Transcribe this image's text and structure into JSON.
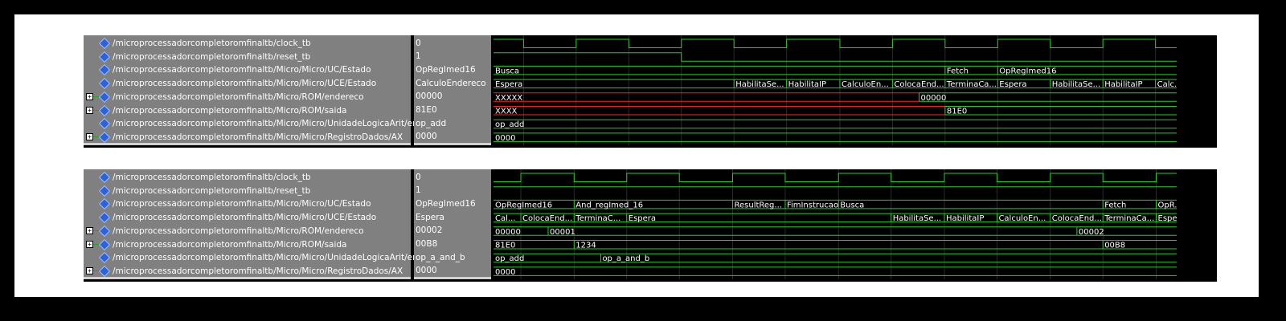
{
  "colors": {
    "background": "#000000",
    "frame": "#ffffff",
    "pane": "#808080",
    "wave_green": "#1fd11f",
    "wave_red": "#ff1e1e",
    "grid": "#2a2a2a",
    "diamond": "#2d62d8"
  },
  "icons": {
    "signal": "diamond-icon",
    "expand": "plus-box-icon"
  },
  "panels": [
    {
      "signals": [
        {
          "name": "/microprocessadorcompletoromfinaltb/clock_tb",
          "value": "0",
          "expandable": false
        },
        {
          "name": "/microprocessadorcompletoromfinaltb/reset_tb",
          "value": "1",
          "expandable": false
        },
        {
          "name": "/microprocessadorcompletoromfinaltb/Micro/Micro/UC/Estado",
          "value": "OpRegImed16",
          "expandable": false
        },
        {
          "name": "/microprocessadorcompletoromfinaltb/Micro/Micro/UCE/Estado",
          "value": "CalculoEndereco",
          "expandable": false
        },
        {
          "name": "/microprocessadorcompletoromfinaltb/Micro/ROM/endereco",
          "value": "00000",
          "expandable": true
        },
        {
          "name": "/microprocessadorcompletoromfinaltb/Micro/ROM/saida",
          "value": "81E0",
          "expandable": true
        },
        {
          "name": "/microprocessadorcompletoromfinaltb/Micro/Micro/UnidadeLogicaArit/enum_op",
          "value": "op_add",
          "expandable": false
        },
        {
          "name": "/microprocessadorcompletoromfinaltb/Micro/Micro/RegistroDados/AX",
          "value": "0000",
          "expandable": true
        }
      ],
      "waves": [
        {
          "kind": "clock",
          "color": "green",
          "edges": [
            0,
            0.044,
            0.121,
            0.198,
            0.275,
            0.352,
            0.429,
            0.507,
            0.584,
            0.661,
            0.738,
            0.815,
            0.892,
            0.969
          ],
          "start_high": true
        },
        {
          "kind": "bit",
          "color": "green",
          "segments": [
            {
              "from": 0,
              "to": 0.275,
              "level": 1
            },
            {
              "from": 0.275,
              "to": 1,
              "level": 0
            }
          ]
        },
        {
          "kind": "bus",
          "color": "green",
          "segments": [
            {
              "from": 0,
              "to": 0.661,
              "label": "Busca"
            },
            {
              "from": 0.661,
              "to": 0.738,
              "label": "Fetch"
            },
            {
              "from": 0.738,
              "to": 1,
              "label": "OpRegImed16"
            }
          ]
        },
        {
          "kind": "bus",
          "color": "green",
          "segments": [
            {
              "from": 0,
              "to": 0.352,
              "label": "Espera"
            },
            {
              "from": 0.352,
              "to": 0.429,
              "label": "HabilitaSe..."
            },
            {
              "from": 0.429,
              "to": 0.507,
              "label": "HabilitaIP"
            },
            {
              "from": 0.507,
              "to": 0.584,
              "label": "CalculoEn..."
            },
            {
              "from": 0.584,
              "to": 0.661,
              "label": "ColocaEnd..."
            },
            {
              "from": 0.661,
              "to": 0.738,
              "label": "TerminaCa..."
            },
            {
              "from": 0.738,
              "to": 0.815,
              "label": "Espera"
            },
            {
              "from": 0.815,
              "to": 0.892,
              "label": "HabilitaSe..."
            },
            {
              "from": 0.892,
              "to": 0.969,
              "label": "HabilitaIP"
            },
            {
              "from": 0.969,
              "to": 1,
              "label": "Calc..."
            }
          ]
        },
        {
          "kind": "bus",
          "color": "mixed",
          "segments": [
            {
              "from": 0,
              "to": 0.623,
              "label": "XXXXX",
              "color": "red"
            },
            {
              "from": 0.623,
              "to": 1,
              "label": "00000",
              "color": "green"
            }
          ]
        },
        {
          "kind": "bus",
          "color": "mixed",
          "segments": [
            {
              "from": 0,
              "to": 0.661,
              "label": "XXXX",
              "color": "red"
            },
            {
              "from": 0.661,
              "to": 1,
              "label": "81E0",
              "color": "green"
            }
          ]
        },
        {
          "kind": "bus",
          "color": "green",
          "segments": [
            {
              "from": 0,
              "to": 1,
              "label": "op_add"
            }
          ]
        },
        {
          "kind": "bus",
          "color": "green",
          "segments": [
            {
              "from": 0,
              "to": 1,
              "label": "0000"
            }
          ]
        }
      ]
    },
    {
      "signals": [
        {
          "name": "/microprocessadorcompletoromfinaltb/clock_tb",
          "value": "0",
          "expandable": false
        },
        {
          "name": "/microprocessadorcompletoromfinaltb/reset_tb",
          "value": "1",
          "expandable": false
        },
        {
          "name": "/microprocessadorcompletoromfinaltb/Micro/Micro/UC/Estado",
          "value": "OpRegImed16",
          "expandable": false
        },
        {
          "name": "/microprocessadorcompletoromfinaltb/Micro/Micro/UCE/Estado",
          "value": "Espera",
          "expandable": false
        },
        {
          "name": "/microprocessadorcompletoromfinaltb/Micro/ROM/endereco",
          "value": "00002",
          "expandable": true
        },
        {
          "name": "/microprocessadorcompletoromfinaltb/Micro/ROM/saida",
          "value": "00B8",
          "expandable": true
        },
        {
          "name": "/microprocessadorcompletoromfinaltb/Micro/Micro/UnidadeLogicaArit/enum_op",
          "value": "op_a_and_b",
          "expandable": false
        },
        {
          "name": "/microprocessadorcompletoromfinaltb/Micro/Micro/RegistroDados/AX",
          "value": "0000",
          "expandable": true
        }
      ],
      "waves": [
        {
          "kind": "clock",
          "color": "green",
          "edges": [
            0,
            0.04,
            0.118,
            0.195,
            0.272,
            0.35,
            0.427,
            0.505,
            0.582,
            0.66,
            0.737,
            0.815,
            0.892,
            0.97
          ],
          "start_high": false
        },
        {
          "kind": "bit",
          "color": "green",
          "segments": [
            {
              "from": 0,
              "to": 1,
              "level": 1
            }
          ]
        },
        {
          "kind": "bus",
          "color": "green",
          "segments": [
            {
              "from": 0,
              "to": 0.118,
              "label": "OpRegImed16"
            },
            {
              "from": 0.118,
              "to": 0.35,
              "label": "And_regImed_16"
            },
            {
              "from": 0.35,
              "to": 0.427,
              "label": "ResultReg..."
            },
            {
              "from": 0.427,
              "to": 0.505,
              "label": "FimInstrucao"
            },
            {
              "from": 0.505,
              "to": 0.892,
              "label": "Busca"
            },
            {
              "from": 0.892,
              "to": 0.97,
              "label": "Fetch"
            },
            {
              "from": 0.97,
              "to": 1,
              "label": "OpR..."
            }
          ]
        },
        {
          "kind": "bus",
          "color": "green",
          "segments": [
            {
              "from": 0,
              "to": 0.04,
              "label": "Cal..."
            },
            {
              "from": 0.04,
              "to": 0.118,
              "label": "ColocaEnd..."
            },
            {
              "from": 0.118,
              "to": 0.195,
              "label": "TerminaC..."
            },
            {
              "from": 0.195,
              "to": 0.582,
              "label": "Espera"
            },
            {
              "from": 0.582,
              "to": 0.66,
              "label": "HabilitaSe..."
            },
            {
              "from": 0.66,
              "to": 0.737,
              "label": "HabilitaIP"
            },
            {
              "from": 0.737,
              "to": 0.815,
              "label": "CalculoEn..."
            },
            {
              "from": 0.815,
              "to": 0.892,
              "label": "ColocaEnd..."
            },
            {
              "from": 0.892,
              "to": 0.97,
              "label": "TerminaCa..."
            },
            {
              "from": 0.97,
              "to": 1,
              "label": "Espe..."
            }
          ]
        },
        {
          "kind": "bus",
          "color": "green",
          "segments": [
            {
              "from": 0,
              "to": 0.08,
              "label": "00000"
            },
            {
              "from": 0.08,
              "to": 0.854,
              "label": "00001"
            },
            {
              "from": 0.854,
              "to": 1,
              "label": "00002"
            }
          ]
        },
        {
          "kind": "bus",
          "color": "green",
          "segments": [
            {
              "from": 0,
              "to": 0.118,
              "label": "81E0"
            },
            {
              "from": 0.118,
              "to": 0.892,
              "label": "1234"
            },
            {
              "from": 0.892,
              "to": 1,
              "label": "00B8"
            }
          ]
        },
        {
          "kind": "bus",
          "color": "green",
          "segments": [
            {
              "from": 0,
              "to": 0.157,
              "label": "op_add"
            },
            {
              "from": 0.157,
              "to": 1,
              "label": "op_a_and_b"
            }
          ]
        },
        {
          "kind": "bus",
          "color": "green",
          "segments": [
            {
              "from": 0,
              "to": 1,
              "label": "0000"
            }
          ]
        }
      ]
    }
  ]
}
